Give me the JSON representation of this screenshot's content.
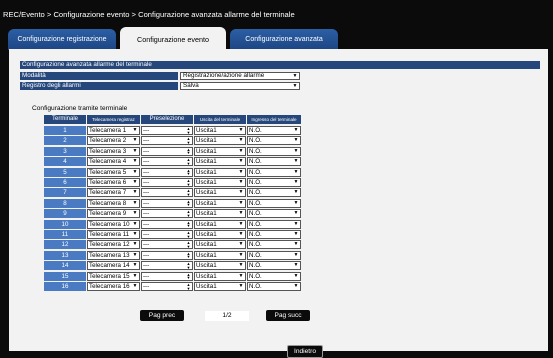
{
  "breadcrumb": "REC/Evento > Configurazione evento > Configurazione avanzata allarme del terminale",
  "tabs": [
    {
      "label": "Configurazione registrazione",
      "active": false
    },
    {
      "label": "Configurazione evento",
      "active": true
    },
    {
      "label": "Configurazione avanzata",
      "active": false
    }
  ],
  "section_title": "Configurazione avanzata allarme del terminale",
  "settings": [
    {
      "label": "Modalità",
      "value": "Registrazione/azione allarme"
    },
    {
      "label": "Registro degli allarmi",
      "value": "Salva"
    }
  ],
  "table_title": "Configurazione tramite terminale",
  "columns": [
    "Terminale",
    "Telecamera registraz",
    "Preselezione",
    "Uscita del terminale",
    "Ingresso del terminale"
  ],
  "rows": [
    {
      "num": "1",
      "camera": "Telecamera 1",
      "preset": "---",
      "output": "Uscita1",
      "input": "N.O."
    },
    {
      "num": "2",
      "camera": "Telecamera 2",
      "preset": "---",
      "output": "Uscita1",
      "input": "N.O."
    },
    {
      "num": "3",
      "camera": "Telecamera 3",
      "preset": "---",
      "output": "Uscita1",
      "input": "N.O."
    },
    {
      "num": "4",
      "camera": "Telecamera 4",
      "preset": "---",
      "output": "Uscita1",
      "input": "N.O."
    },
    {
      "num": "5",
      "camera": "Telecamera 5",
      "preset": "---",
      "output": "Uscita1",
      "input": "N.O."
    },
    {
      "num": "6",
      "camera": "Telecamera 6",
      "preset": "---",
      "output": "Uscita1",
      "input": "N.O."
    },
    {
      "num": "7",
      "camera": "Telecamera 7",
      "preset": "---",
      "output": "Uscita1",
      "input": "N.O."
    },
    {
      "num": "8",
      "camera": "Telecamera 8",
      "preset": "---",
      "output": "Uscita1",
      "input": "N.O."
    },
    {
      "num": "9",
      "camera": "Telecamera 9",
      "preset": "---",
      "output": "Uscita1",
      "input": "N.O."
    },
    {
      "num": "10",
      "camera": "Telecamera 10",
      "preset": "---",
      "output": "Uscita1",
      "input": "N.O."
    },
    {
      "num": "11",
      "camera": "Telecamera 11",
      "preset": "---",
      "output": "Uscita1",
      "input": "N.O."
    },
    {
      "num": "12",
      "camera": "Telecamera 12",
      "preset": "---",
      "output": "Uscita1",
      "input": "N.O."
    },
    {
      "num": "13",
      "camera": "Telecamera 13",
      "preset": "---",
      "output": "Uscita1",
      "input": "N.O."
    },
    {
      "num": "14",
      "camera": "Telecamera 14",
      "preset": "---",
      "output": "Uscita1",
      "input": "N.O."
    },
    {
      "num": "15",
      "camera": "Telecamera 15",
      "preset": "---",
      "output": "Uscita1",
      "input": "N.O."
    },
    {
      "num": "16",
      "camera": "Telecamera 16",
      "preset": "---",
      "output": "Uscita1",
      "input": "N.O."
    }
  ],
  "pagination": {
    "prev": "Pag prec",
    "page": "1/2",
    "next": "Pag succ"
  },
  "back": "Indietro",
  "icons": {
    "dropdown": "triangle-down-icon",
    "spinner": "up-down-spinner-icon"
  },
  "colors": {
    "header_blue": "#26477c",
    "number_blue": "#4a7ac2",
    "tab_blue": "#2c5fa5",
    "panel": "#f2f2f2",
    "background": "#0b0b0b"
  }
}
